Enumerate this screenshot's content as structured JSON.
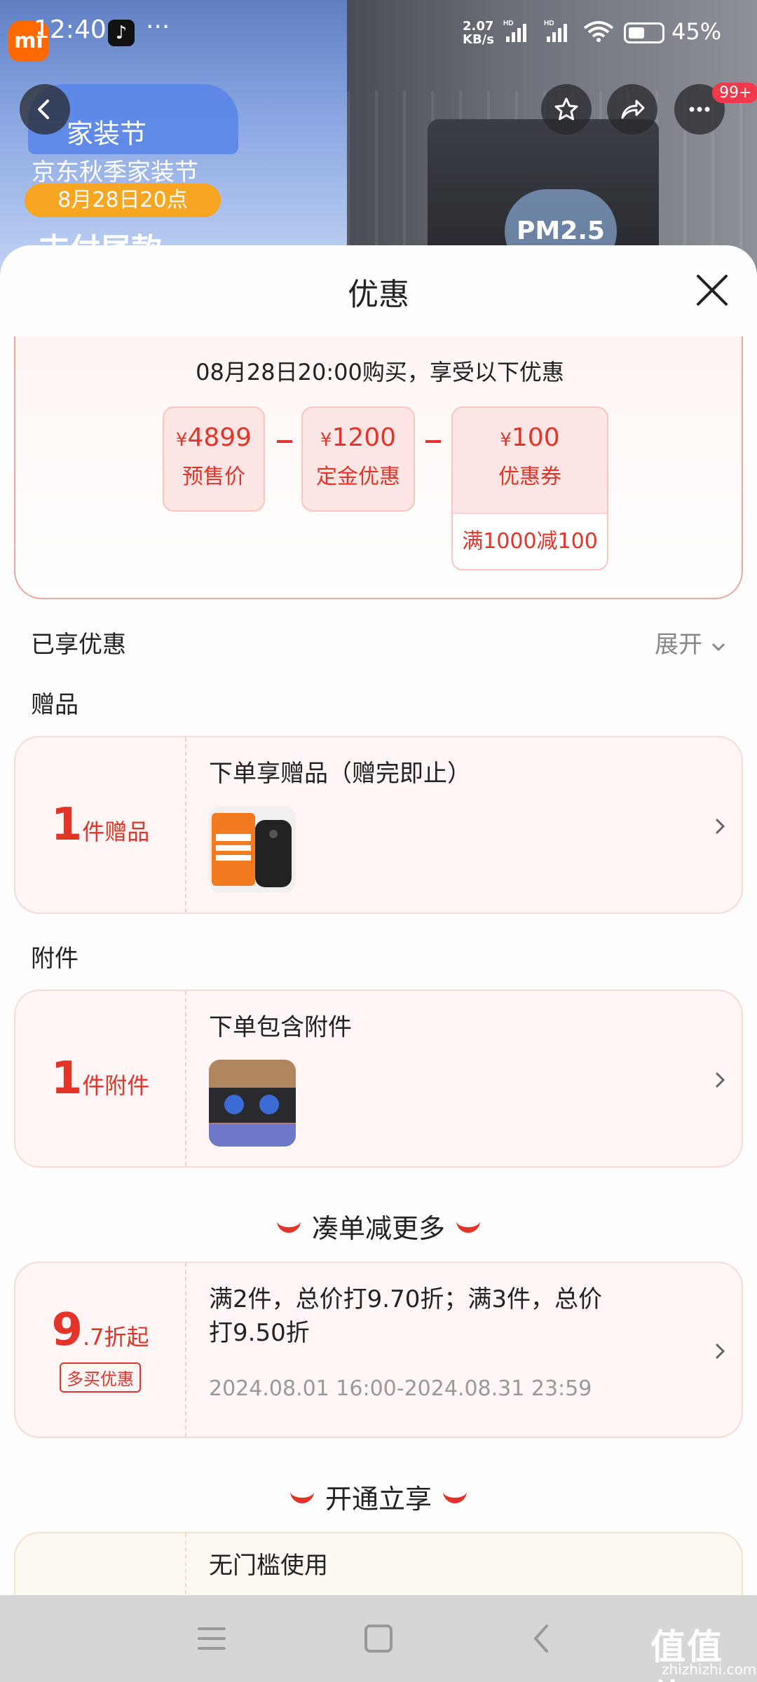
{
  "status_bar": {
    "time": "12:40",
    "more": "···",
    "net_speed_value": "2.07",
    "net_speed_unit": "KB/s",
    "battery": "45%",
    "icons": [
      "tiktok-icon",
      "signal-hd-icon",
      "signal-hd-icon",
      "wifi-icon",
      "battery-icon"
    ]
  },
  "background": {
    "house_title": "家装节",
    "line1": "京东秋季家装节",
    "pill": "8月28日20点",
    "line3": "支付尾款",
    "pm_badge": "PM2.5",
    "mi_logo": "mi",
    "more_badge": "99+"
  },
  "sheet": {
    "title": "优惠",
    "summary": {
      "caption": "08月28日20:00购买，享受以下优惠",
      "boxes": [
        {
          "currency": "¥",
          "amount": "4899",
          "label": "预售价"
        },
        {
          "currency": "¥",
          "amount": "1200",
          "label": "定金优惠"
        },
        {
          "currency": "¥",
          "amount": "100",
          "label": "优惠券",
          "condition": "满1000减100"
        }
      ]
    },
    "enjoyed_label": "已享优惠",
    "expand_label": "展开",
    "gift_section_label": "赠品",
    "gift": {
      "count": "1",
      "unit": "件赠品",
      "title": "下单享赠品（赠完即止）"
    },
    "accessory_section_label": "附件",
    "accessory": {
      "count": "1",
      "unit": "件附件",
      "title": "下单包含附件"
    },
    "bundle_heading": "凑单减更多",
    "bundle": {
      "big": "9",
      "small": ".7折起",
      "tag": "多买优惠",
      "title_line1": "满2件，总价打9.70折；满3件，总价",
      "title_line2": "打9.50折",
      "period": "2024.08.01 16:00-2024.08.31 23:59"
    },
    "membership_heading": "开通立享",
    "membership": {
      "title": "无门槛使用"
    }
  },
  "watermark": {
    "text": "值值值",
    "sub": "zhizhizhi.com"
  },
  "colors": {
    "accent": "#e3342a",
    "card_bg": "#fff6f5",
    "card_border": "#f6dcd8"
  }
}
